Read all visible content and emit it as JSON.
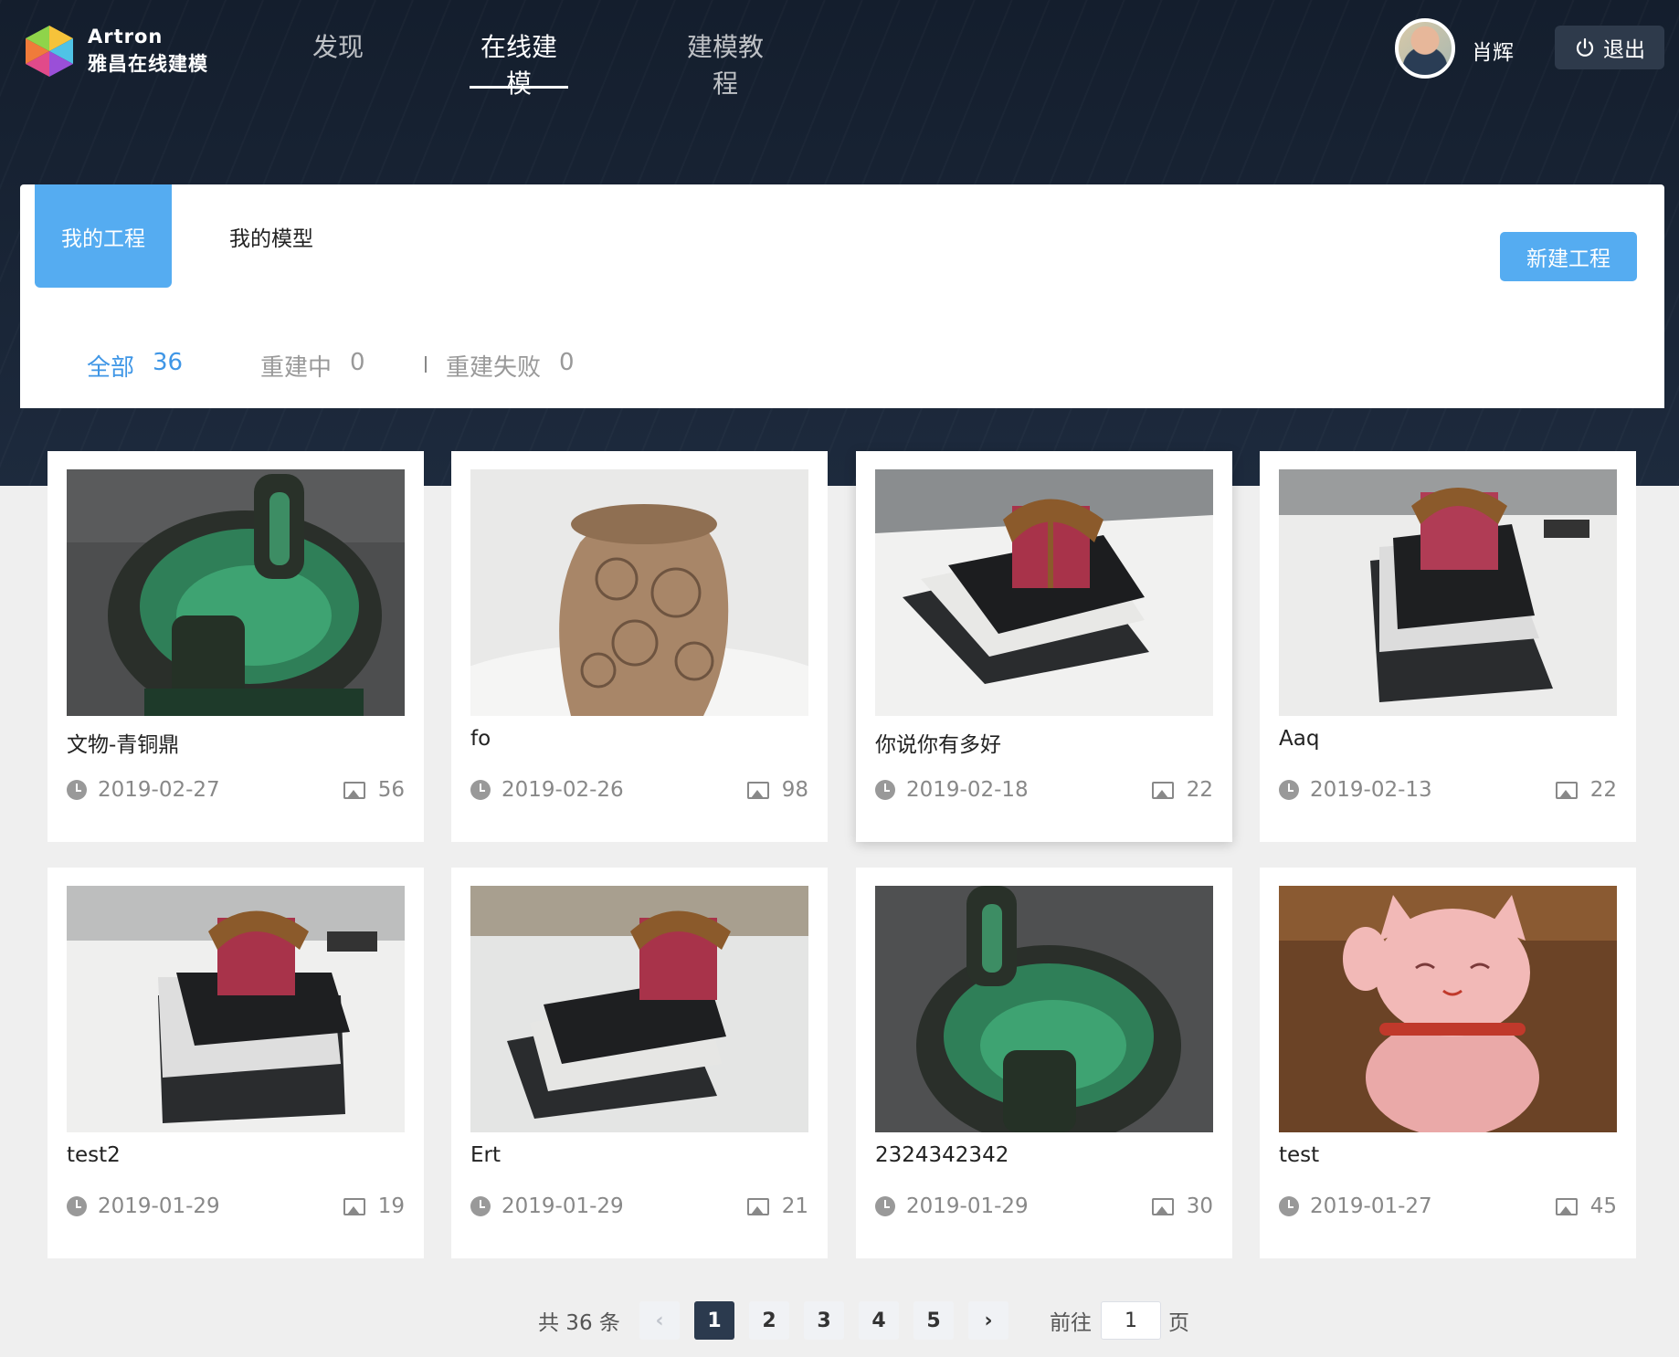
{
  "header": {
    "logo_en": "Artron",
    "logo_cn": "雅昌在线建模",
    "nav": [
      {
        "label": "发现",
        "active": false
      },
      {
        "label": "在线建模",
        "active": true
      },
      {
        "label": "建模教程",
        "active": false
      }
    ],
    "username": "肖辉",
    "logout_label": "退出"
  },
  "panel": {
    "tabs": [
      {
        "label": "我的工程",
        "active": true
      },
      {
        "label": "我的模型",
        "active": false
      }
    ],
    "new_button_label": "新建工程",
    "filters": [
      {
        "label": "全部",
        "count": "36",
        "active": true
      },
      {
        "label": "重建中",
        "count": "0",
        "active": false
      },
      {
        "label": "重建失败",
        "count": "0",
        "active": false
      }
    ]
  },
  "projects": [
    {
      "title": "文物-青铜鼎",
      "date": "2019-02-27",
      "images": "56",
      "thumb": "bronze-vessel"
    },
    {
      "title": "fo",
      "date": "2019-02-26",
      "images": "98",
      "thumb": "stone-head"
    },
    {
      "title": "你说你有多好",
      "date": "2019-02-18",
      "images": "22",
      "thumb": "gift-box-on-books"
    },
    {
      "title": "Aaq",
      "date": "2019-02-13",
      "images": "22",
      "thumb": "gift-box-on-books"
    },
    {
      "title": "test2",
      "date": "2019-01-29",
      "images": "19",
      "thumb": "gift-box-on-books"
    },
    {
      "title": "Ert",
      "date": "2019-01-29",
      "images": "21",
      "thumb": "gift-box-on-books"
    },
    {
      "title": "2324342342",
      "date": "2019-01-29",
      "images": "30",
      "thumb": "bronze-vessel"
    },
    {
      "title": "test",
      "date": "2019-01-27",
      "images": "45",
      "thumb": "lucky-cat"
    }
  ],
  "pagination": {
    "total_label": "共 36 条",
    "prev": "‹",
    "pages": [
      "1",
      "2",
      "3",
      "4",
      "5"
    ],
    "current": "1",
    "next": "›",
    "goto_label": "前往",
    "goto_value": "1",
    "page_suffix": "页"
  },
  "colors": {
    "accent": "#55acf1",
    "header_bg": "#141e2d",
    "active_page": "#2b3a4e"
  }
}
